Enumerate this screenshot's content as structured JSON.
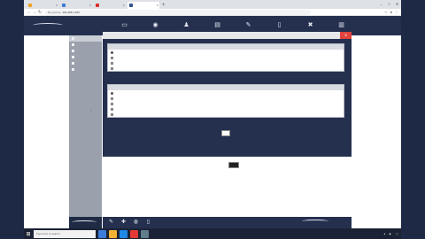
{
  "browser": {
    "tabs": [
      {
        "title": "",
        "color": "#f0a21b",
        "active": false
      },
      {
        "title": "",
        "color": "#3a7bd5",
        "active": false
      },
      {
        "title": "",
        "color": "#d93025",
        "active": false
      },
      {
        "title": "",
        "color": "#2f4f8f",
        "active": true
      }
    ],
    "new_tab_glyph": "+",
    "window_controls": [
      "–",
      "□",
      "✕"
    ],
    "address": {
      "secure_label": "Not secure",
      "url": "192.168.1.100"
    }
  },
  "app": {
    "menu": [
      {
        "icon": "monitor-icon",
        "glyph": "▭",
        "label": ""
      },
      {
        "icon": "camera-icon",
        "glyph": "◉",
        "label": ""
      },
      {
        "icon": "user-icon",
        "glyph": "♟",
        "label": ""
      },
      {
        "icon": "recorder-icon",
        "glyph": "▤",
        "label": ""
      },
      {
        "icon": "brush-icon",
        "glyph": "✎",
        "label": ""
      },
      {
        "icon": "file-icon",
        "glyph": "▯",
        "label": ""
      },
      {
        "icon": "tools-icon",
        "glyph": "✖",
        "label": ""
      },
      {
        "icon": "document-icon",
        "glyph": "▥",
        "label": ""
      }
    ],
    "sidebar": [
      "",
      "",
      "",
      "",
      "",
      ""
    ],
    "panel": {
      "title": "",
      "close_glyph": "✕",
      "group1": {
        "header": "",
        "options": [
          "",
          "",
          "",
          ""
        ]
      },
      "group2": {
        "header": "",
        "options": [
          "",
          "",
          "",
          "",
          ""
        ]
      },
      "apply_label": "",
      "close_label": ""
    }
  },
  "taskbar": {
    "search_placeholder": "Type here to search",
    "time": "",
    "date": ""
  }
}
